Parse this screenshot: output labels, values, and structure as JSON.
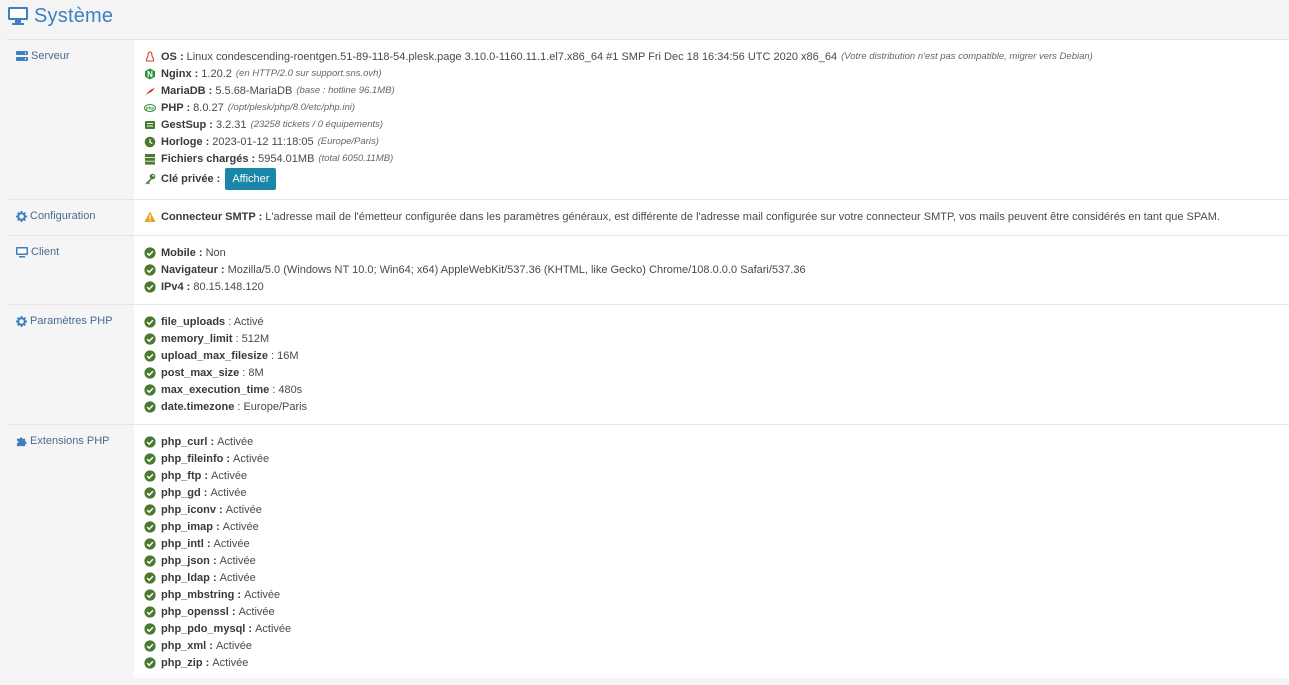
{
  "page": {
    "title": "Système",
    "accent": "#3d7fc1"
  },
  "sections": {
    "serveur": {
      "label": "Serveur",
      "os": {
        "key": "OS :",
        "value": "Linux condescending-roentgen.51-89-118-54.plesk.page 3.10.0-1160.11.1.el7.x86_64 #1 SMP Fri Dec 18 16:34:56 UTC 2020 x86_64",
        "note": "(Votre distribution n'est pas compatible, migrer vers Debian)"
      },
      "nginx": {
        "key": "Nginx :",
        "value": "1.20.2",
        "note": "(en HTTP/2.0 sur support.sns.ovh)"
      },
      "mariadb": {
        "key": "MariaDB :",
        "value": "5.5.68-MariaDB",
        "note": "(base : hotline 96.1MB)"
      },
      "php": {
        "key": "PHP :",
        "value": "8.0.27",
        "note": "(/opt/plesk/php/8.0/etc/php.ini)"
      },
      "gestsup": {
        "key": "GestSup :",
        "value": "3.2.31",
        "note": "(23258 tickets / 0 équipements)"
      },
      "horloge": {
        "key": "Horloge :",
        "value": "2023-01-12 11:18:05",
        "note": "(Europe/Paris)"
      },
      "fichiers": {
        "key": "Fichiers chargés :",
        "value": "5954.01MB",
        "note": "(total 6050.11MB)"
      },
      "cle": {
        "key": "Clé privée :",
        "button": "Afficher"
      }
    },
    "configuration": {
      "label": "Configuration",
      "smtp": {
        "key": "Connecteur SMTP :",
        "value": "L'adresse mail de l'émetteur configurée dans les paramètres généraux, est différente de l'adresse mail configurée sur votre connecteur SMTP, vos mails peuvent être considérés en tant que SPAM."
      }
    },
    "client": {
      "label": "Client",
      "items": [
        {
          "key": "Mobile :",
          "value": "Non"
        },
        {
          "key": "Navigateur :",
          "value": "Mozilla/5.0 (Windows NT 10.0; Win64; x64) AppleWebKit/537.36 (KHTML, like Gecko) Chrome/108.0.0.0 Safari/537.36"
        },
        {
          "key": "IPv4 :",
          "value": "80.15.148.120"
        }
      ]
    },
    "php_params": {
      "label": "Paramètres PHP",
      "items": [
        {
          "key": "file_uploads",
          "value": ": Activé"
        },
        {
          "key": "memory_limit",
          "value": ": 512M"
        },
        {
          "key": "upload_max_filesize",
          "value": ": 16M"
        },
        {
          "key": "post_max_size",
          "value": ": 8M"
        },
        {
          "key": "max_execution_time",
          "value": ": 480s"
        },
        {
          "key": "date.timezone",
          "value": ": Europe/Paris"
        }
      ]
    },
    "php_ext": {
      "label": "Extensions PHP",
      "items": [
        {
          "key": "php_curl :",
          "value": "Activée"
        },
        {
          "key": "php_fileinfo :",
          "value": "Activée"
        },
        {
          "key": "php_ftp :",
          "value": "Activée"
        },
        {
          "key": "php_gd :",
          "value": "Activée"
        },
        {
          "key": "php_iconv :",
          "value": "Activée"
        },
        {
          "key": "php_imap :",
          "value": "Activée"
        },
        {
          "key": "php_intl :",
          "value": "Activée"
        },
        {
          "key": "php_json :",
          "value": "Activée"
        },
        {
          "key": "php_ldap :",
          "value": "Activée"
        },
        {
          "key": "php_mbstring :",
          "value": "Activée"
        },
        {
          "key": "php_openssl :",
          "value": "Activée"
        },
        {
          "key": "php_pdo_mysql :",
          "value": "Activée"
        },
        {
          "key": "php_xml :",
          "value": "Activée"
        },
        {
          "key": "php_zip :",
          "value": "Activée"
        }
      ]
    }
  }
}
